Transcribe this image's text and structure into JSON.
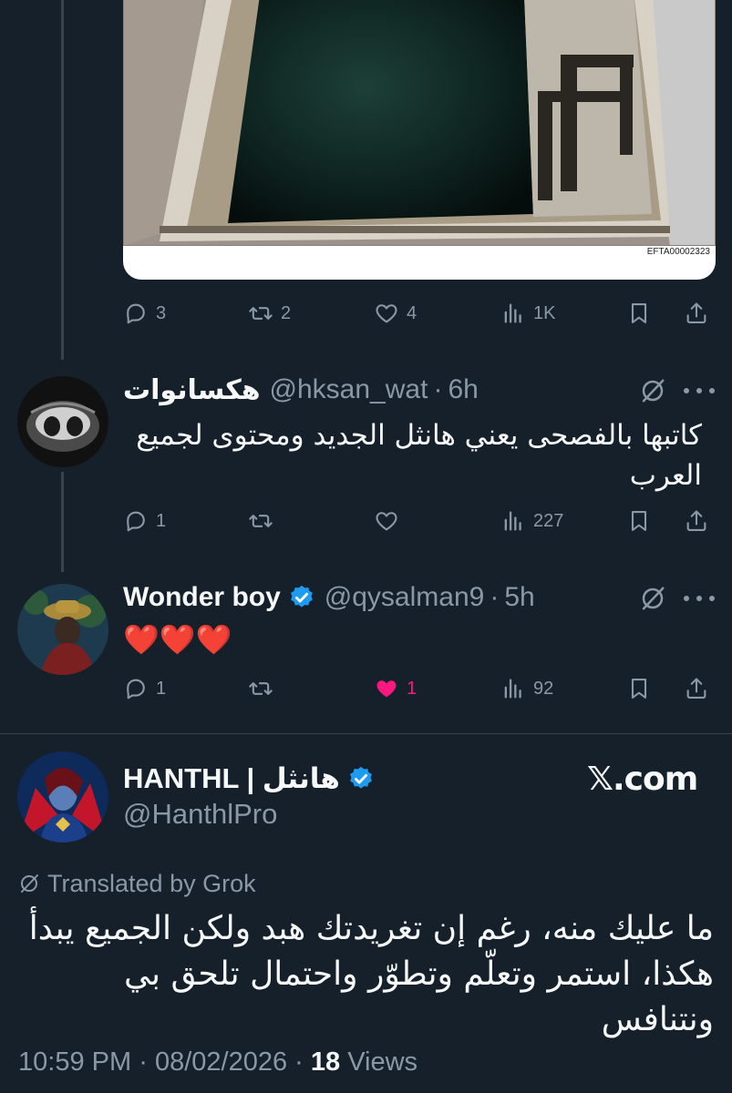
{
  "media": {
    "caption": "EFTA00002323"
  },
  "post_actions": {
    "replies": "3",
    "reposts": "2",
    "likes": "4",
    "views": "1K"
  },
  "replies": [
    {
      "name": "هكسانوات",
      "handle": "@hksan_wat",
      "time": "6h",
      "text": "كاتبها بالفصحى يعني هانثل الجديد ومحتوى لجميع العرب",
      "replies": "1",
      "reposts": "",
      "likes": "",
      "views": "227"
    },
    {
      "name": "Wonder boy",
      "handle": "@qysalman9",
      "time": "5h",
      "text": "❤️❤️❤️",
      "replies": "1",
      "reposts": "",
      "likes": "1",
      "views": "92"
    }
  ],
  "main_post": {
    "name": "HANTHL | هانثل",
    "handle": "@HanthlPro",
    "watermark": "𝕏.com",
    "translated_label": "Translated by Grok",
    "text": "ما عليك منه، رغم إن تغريدتك هبد ولكن الجميع يبدأ هكذا، استمر وتعلّم وتطوّر واحتمال تلحق بي ونتنافس",
    "time": "10:59 PM",
    "date": "08/02/2026",
    "views_count": "18",
    "views_label": "Views",
    "separator": "·"
  },
  "colors": {
    "background": "#15202b",
    "muted": "#8b98a5",
    "like": "#f91880",
    "verified": "#1d9bf0"
  }
}
